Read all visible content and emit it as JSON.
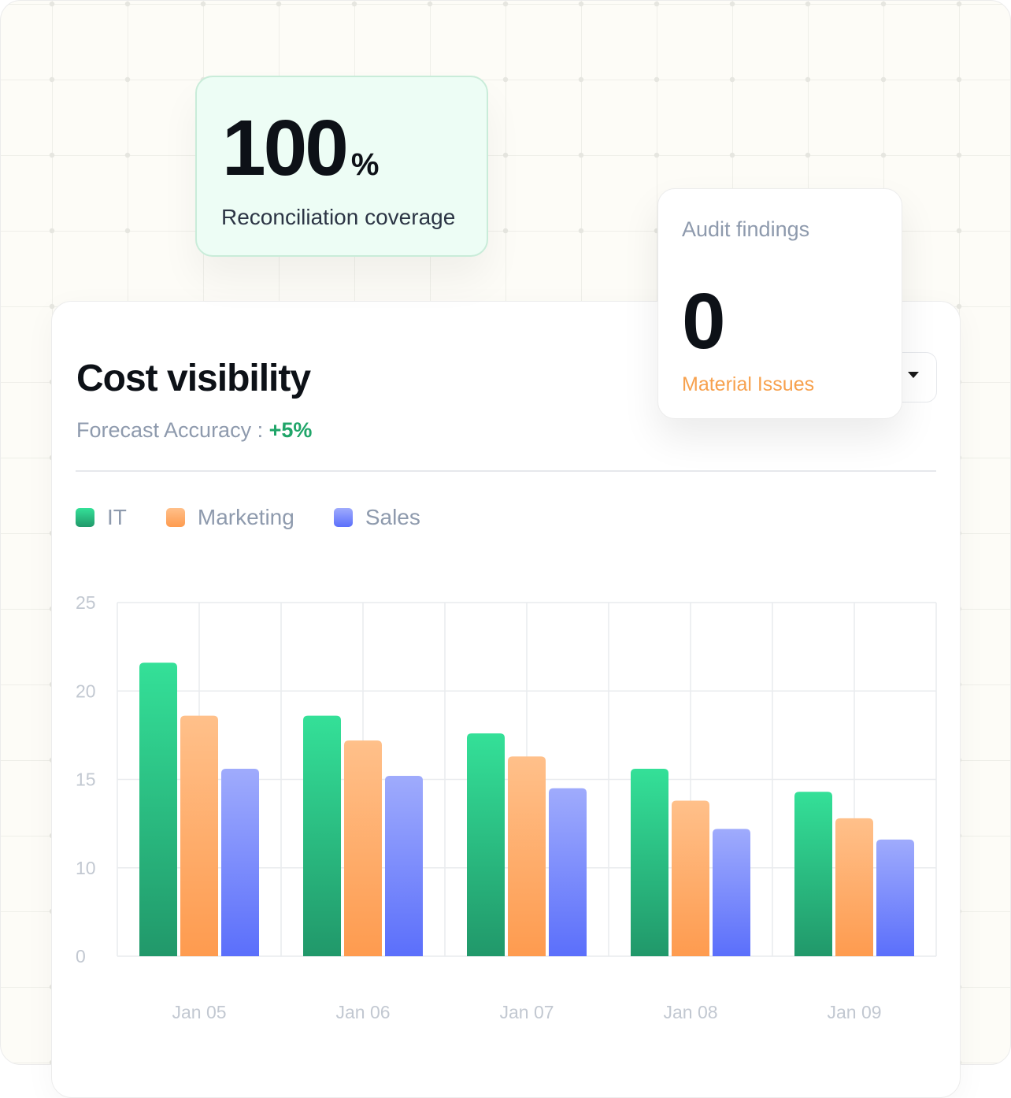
{
  "coverage": {
    "value": "100",
    "unit": "%",
    "label": "Reconciliation coverage"
  },
  "audit": {
    "title": "Audit findings",
    "value": "0",
    "sub_label": "Material Issues"
  },
  "card": {
    "title": "Cost visibility",
    "subtitle_prefix": "Forecast Accuracy : ",
    "subtitle_value": "+5%"
  },
  "colors": {
    "it_top": "#34e098",
    "it_bottom": "#21986a",
    "marketing_top": "#ffc08a",
    "marketing_bottom": "#fe9b4f",
    "sales_top": "#9fabfc",
    "sales_bottom": "#5b6ffb",
    "accent_green": "#20a569",
    "accent_orange": "#f7a14e"
  },
  "chart_data": {
    "type": "bar",
    "categories": [
      "Jan 05",
      "Jan 06",
      "Jan 07",
      "Jan 08",
      "Jan 09"
    ],
    "series": [
      {
        "name": "IT",
        "values": [
          21.6,
          18.6,
          17.6,
          15.6,
          14.3
        ]
      },
      {
        "name": "Marketing",
        "values": [
          18.6,
          17.2,
          16.3,
          13.8,
          12.8
        ]
      },
      {
        "name": "Sales",
        "values": [
          15.6,
          15.2,
          14.5,
          12.2,
          11.6
        ]
      }
    ],
    "y_ticks": [
      "0",
      "10",
      "15",
      "20",
      "25"
    ],
    "ylim": [
      5,
      25
    ],
    "grid": true,
    "legend_position": "top-left",
    "title": "",
    "xlabel": "",
    "ylabel": ""
  }
}
